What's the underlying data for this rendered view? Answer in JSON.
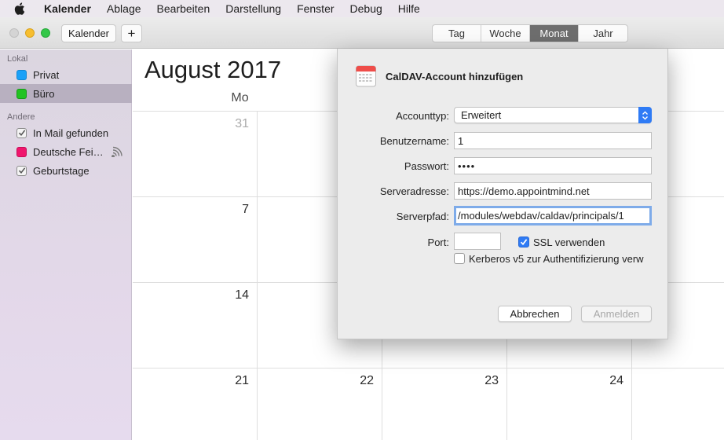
{
  "menubar": {
    "items": [
      "Kalender",
      "Ablage",
      "Bearbeiten",
      "Darstellung",
      "Fenster",
      "Debug",
      "Hilfe"
    ]
  },
  "toolbar": {
    "calendars_label": "Kalender",
    "add_label": "+",
    "views": [
      "Tag",
      "Woche",
      "Monat",
      "Jahr"
    ],
    "active_view": "Monat"
  },
  "sidebar": {
    "groups": [
      {
        "header": "Lokal",
        "items": [
          {
            "label": "Privat",
            "color": "#1aa1f8",
            "selected": false
          },
          {
            "label": "Büro",
            "color": "#22c322",
            "selected": true
          }
        ]
      },
      {
        "header": "Andere",
        "items": [
          {
            "label": "In Mail gefunden",
            "checked": true
          },
          {
            "label": "Deutsche Fei…",
            "color": "#f0166d",
            "subscribed": true
          },
          {
            "label": "Geburtstage",
            "checked": true
          }
        ]
      }
    ]
  },
  "calendar": {
    "month_title": "August 2017",
    "weekday_header": "Mo",
    "week_rows": [
      [
        "31",
        "",
        "",
        "",
        ""
      ],
      [
        "7",
        "",
        "",
        "",
        ""
      ],
      [
        "14",
        "",
        "",
        "",
        ""
      ],
      [
        "21",
        "22",
        "23",
        "24",
        ""
      ]
    ]
  },
  "dialog": {
    "title": "CalDAV-Account hinzufügen",
    "fields": {
      "account_type_label": "Accounttyp:",
      "account_type_value": "Erweitert",
      "username_label": "Benutzername:",
      "username_value": "1",
      "password_label": "Passwort:",
      "password_value": "••••",
      "server_address_label": "Serveradresse:",
      "server_address_value": "https://demo.appointmind.net",
      "server_path_label": "Serverpfad:",
      "server_path_value": "/modules/webdav/caldav/principals/1",
      "port_label": "Port:",
      "port_value": ""
    },
    "ssl_label": "SSL verwenden",
    "ssl_checked": true,
    "kerberos_label": "Kerberos v5 zur Authentifizierung verw",
    "kerberos_checked": false,
    "cancel_label": "Abbrechen",
    "signin_label": "Anmelden"
  }
}
